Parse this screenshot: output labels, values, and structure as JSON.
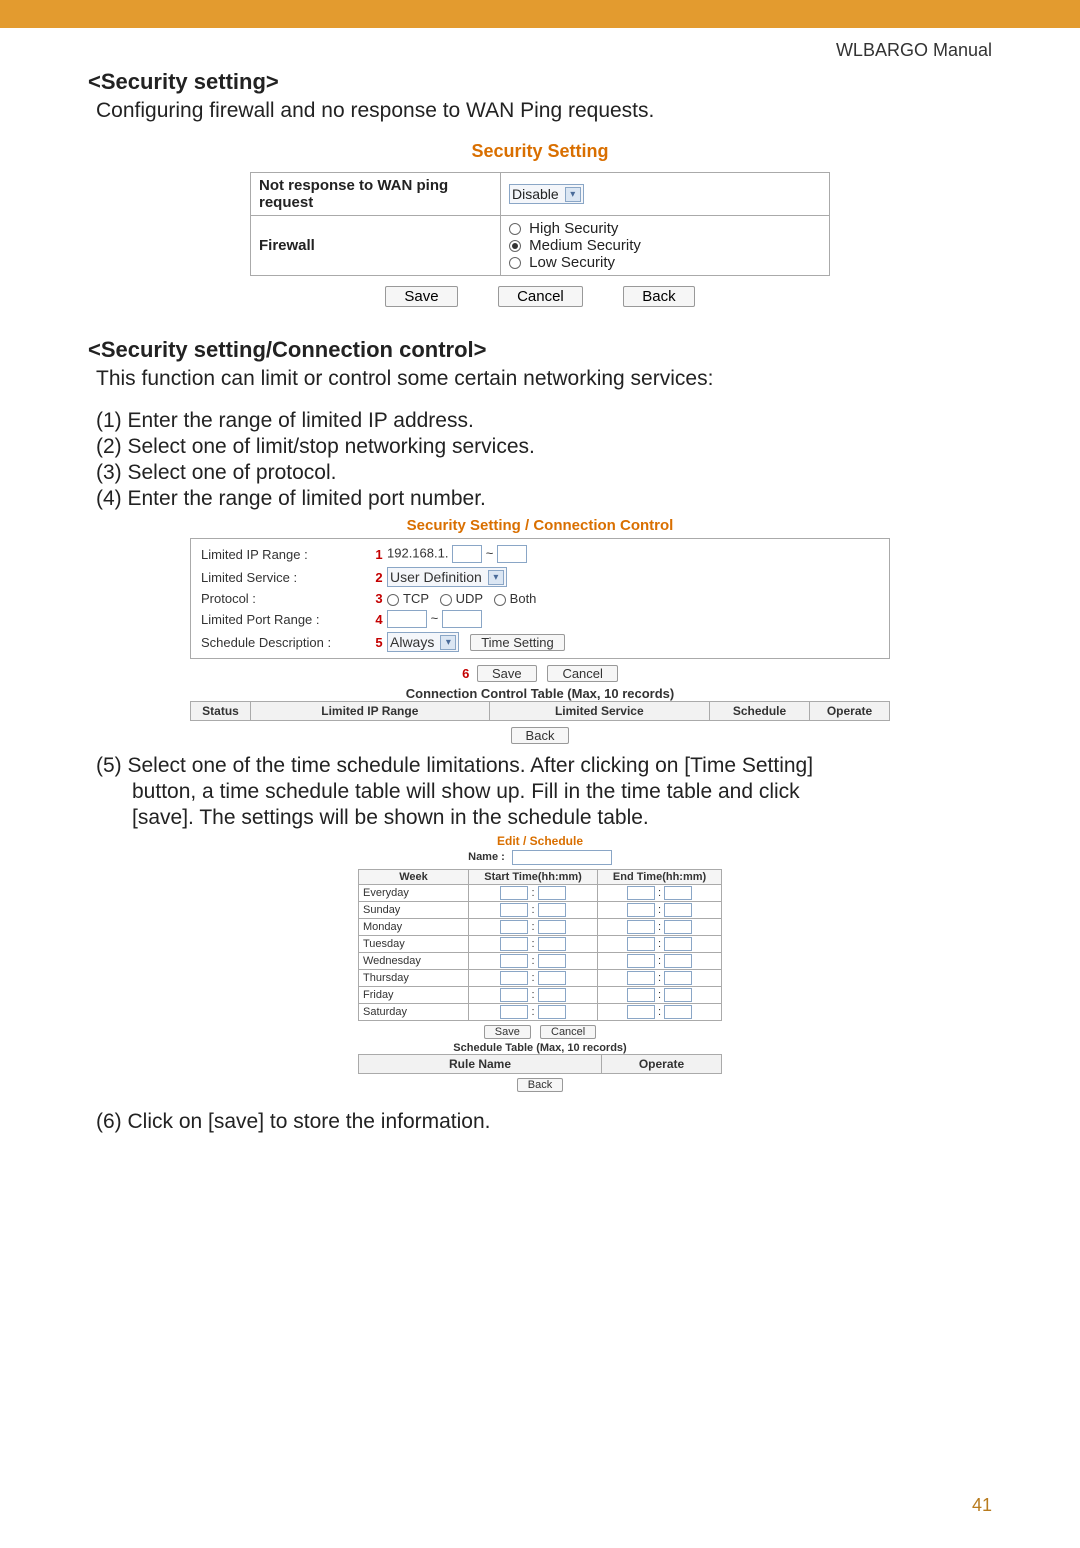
{
  "header": {
    "manual": "WLBARGO Manual"
  },
  "sec1": {
    "title": "<Security setting>",
    "desc": "Configuring firewall and no response to WAN Ping requests."
  },
  "ss": {
    "heading": "Security Setting",
    "row1_label": "Not response to WAN ping request",
    "row1_value": "Disable",
    "row2_label": "Firewall",
    "opt_high": "High Security",
    "opt_med": "Medium Security",
    "opt_low": "Low Security",
    "btn_save": "Save",
    "btn_cancel": "Cancel",
    "btn_back": "Back"
  },
  "sec2": {
    "title": "<Security setting/Connection control>",
    "desc": "This function can limit or control some certain networking services:",
    "s1": "(1) Enter the range of limited IP address.",
    "s2": "(2) Select one of limit/stop networking services.",
    "s3": "(3) Select one of protocol.",
    "s4": "(4) Enter the range of limited port number.",
    "s5a": "(5) Select one of the time schedule limitations.  After clicking on [Time Setting]",
    "s5b": "button, a time schedule table will show up. Fill in the time table and click",
    "s5c": "[save]. The settings will be shown in the schedule table.",
    "s6": "(6) Click on [save] to store the information."
  },
  "cc": {
    "heading": "Security Setting / Connection Control",
    "l_ip": "Limited IP Range :",
    "l_service": "Limited Service :",
    "l_protocol": "Protocol :",
    "l_port": "Limited Port Range :",
    "l_sched": "Schedule Description :",
    "n1": "1",
    "n2": "2",
    "n3": "3",
    "n4": "4",
    "n5": "5",
    "n6": "6",
    "ip_prefix": "192.168.1.",
    "tilde": "~",
    "service_value": "User Definition",
    "proto_tcp": "TCP",
    "proto_udp": "UDP",
    "proto_both": "Both",
    "always": "Always",
    "time_setting": "Time Setting",
    "btn_save": "Save",
    "btn_cancel": "Cancel",
    "table_caption": "Connection Control Table (Max, 10 records)",
    "th_status": "Status",
    "th_ip": "Limited IP Range",
    "th_service": "Limited Service",
    "th_sched": "Schedule",
    "th_operate": "Operate",
    "btn_back": "Back"
  },
  "sch": {
    "heading": "Edit / Schedule",
    "name_label": "Name :",
    "th_week": "Week",
    "th_start": "Start Time(hh:mm)",
    "th_end": "End Time(hh:mm)",
    "days": [
      "Everyday",
      "Sunday",
      "Monday",
      "Tuesday",
      "Wednesday",
      "Thursday",
      "Friday",
      "Saturday"
    ],
    "colon": ":",
    "btn_save": "Save",
    "btn_cancel": "Cancel",
    "list_caption": "Schedule Table (Max, 10 records)",
    "th_rule": "Rule Name",
    "th_operate": "Operate",
    "btn_back": "Back"
  },
  "page_no": "41"
}
